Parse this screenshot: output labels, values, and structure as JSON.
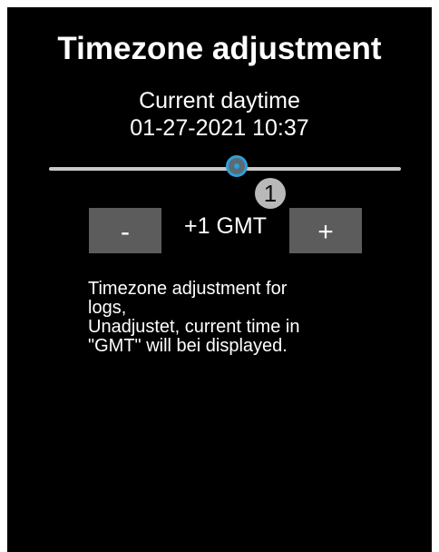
{
  "screen": {
    "title": "Timezone adjustment",
    "daytime_label": "Current daytime",
    "daytime_value": "01-27-2021 10:37"
  },
  "slider": {
    "value": 1,
    "bubble_text": "1"
  },
  "controls": {
    "minus_label": "-",
    "plus_label": "+",
    "timezone_label": "+1 GMT"
  },
  "description": {
    "lines": [
      "Timezone adjustment for",
      "logs,",
      "Unadjustet, current time in",
      "\"GMT\" will bei displayed."
    ]
  },
  "colors": {
    "background": "#000000",
    "text": "#ffffff",
    "button": "#5c5c5c",
    "slider_track": "#c8c8c8",
    "slider_accent": "#2f9fd6",
    "bubble": "#b9b9b9"
  }
}
